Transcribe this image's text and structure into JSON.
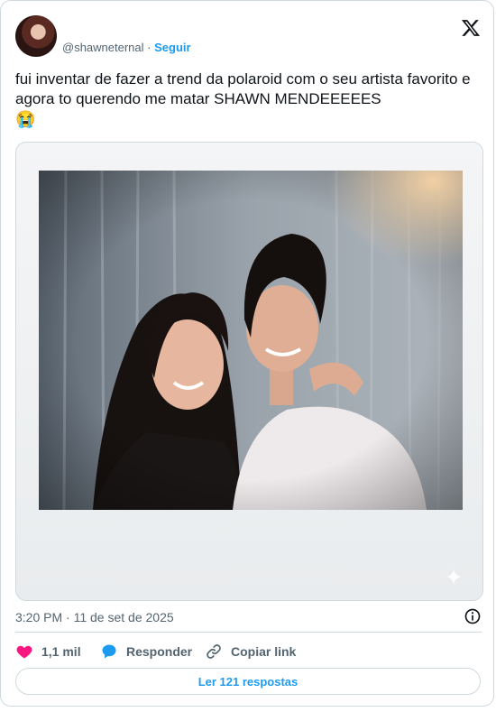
{
  "author": {
    "handle": "@shawneternal",
    "separator": "·",
    "follow_label": "Seguir"
  },
  "tweet": {
    "text": "fui inventar de fazer a trend da polaroid com o seu artista favorito e agora to querendo me matar SHAWN MENDEEEEES",
    "emoji": "😭",
    "timestamp": "3:20 PM · 11 de set de 2025"
  },
  "actions": {
    "likes": "1,1 mil",
    "reply_label": "Responder",
    "copy_label": "Copiar link",
    "read_replies_label": "Ler 121 respostas"
  },
  "icons": {
    "brand": "x-logo-icon",
    "like": "heart-icon",
    "reply": "speech-bubble-icon",
    "copy": "link-icon",
    "info": "info-icon"
  },
  "colors": {
    "accent": "#1d9bf0",
    "like": "#f91880",
    "muted_text": "#536471",
    "border": "#cfd9de"
  }
}
